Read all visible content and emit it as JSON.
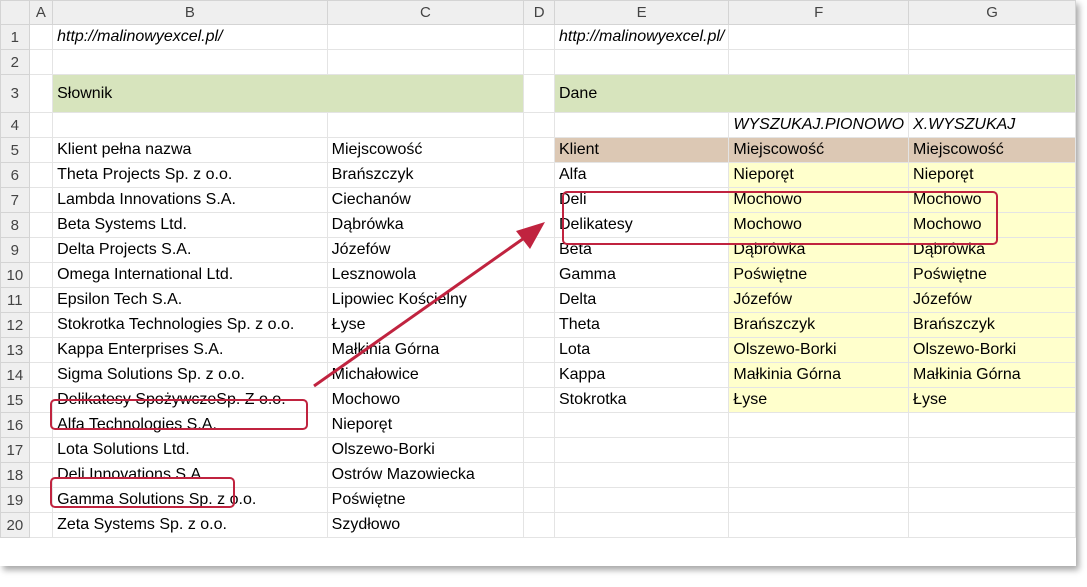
{
  "columns": [
    "",
    "A",
    "B",
    "C",
    "D",
    "E",
    "F",
    "G"
  ],
  "rows": [
    "1",
    "2",
    "3",
    "4",
    "5",
    "6",
    "7",
    "8",
    "9",
    "10",
    "11",
    "12",
    "13",
    "14",
    "15",
    "16",
    "17",
    "18",
    "19",
    "20"
  ],
  "link_left": "http://malinowyexcel.pl/",
  "link_right": "http://malinowyexcel.pl/",
  "dictionary": {
    "title": "Słownik",
    "header_client": "Klient pełna nazwa",
    "header_city": "Miejscowość",
    "rows": [
      {
        "client": "Theta Projects Sp. z o.o.",
        "city": "Brańszczyk"
      },
      {
        "client": "Lambda Innovations S.A.",
        "city": "Ciechanów"
      },
      {
        "client": "Beta Systems Ltd.",
        "city": "Dąbrówka"
      },
      {
        "client": "Delta Projects S.A.",
        "city": "Józefów"
      },
      {
        "client": "Omega International Ltd.",
        "city": "Lesznowola"
      },
      {
        "client": "Epsilon Tech S.A.",
        "city": "Lipowiec Kościelny"
      },
      {
        "client": "Stokrotka Technologies Sp. z o.o.",
        "city": "Łyse"
      },
      {
        "client": "Kappa Enterprises S.A.",
        "city": "Małkinia Górna"
      },
      {
        "client": "Sigma Solutions Sp. z o.o.",
        "city": "Michałowice"
      },
      {
        "client": "Delikatesy SpożywczeSp. Z o.o.",
        "city": "Mochowo"
      },
      {
        "client": "Alfa Technologies S.A.",
        "city": "Nieporęt"
      },
      {
        "client": "Lota Solutions Ltd.",
        "city": "Olszewo-Borki"
      },
      {
        "client": "Deli Innovations S.A.",
        "city": "Ostrów Mazowiecka"
      },
      {
        "client": "Gamma Solutions Sp. z o.o.",
        "city": "Poświętne"
      },
      {
        "client": "Zeta Systems Sp. z o.o.",
        "city": "Szydłowo"
      }
    ]
  },
  "data_table": {
    "title": "Dane",
    "note_f": "WYSZUKAJ.PIONOWO",
    "note_g": "X.WYSZUKAJ",
    "header_client": "Klient",
    "header_city_f": "Miejscowość",
    "header_city_g": "Miejscowość",
    "rows": [
      {
        "client": "Alfa",
        "vlookup": "Nieporęt",
        "xlookup": "Nieporęt"
      },
      {
        "client": "Deli",
        "vlookup": "Mochowo",
        "xlookup": "Mochowo"
      },
      {
        "client": "Delikatesy",
        "vlookup": "Mochowo",
        "xlookup": "Mochowo"
      },
      {
        "client": "Beta",
        "vlookup": "Dąbrówka",
        "xlookup": "Dąbrówka"
      },
      {
        "client": "Gamma",
        "vlookup": "Poświętne",
        "xlookup": "Poświętne"
      },
      {
        "client": "Delta",
        "vlookup": "Józefów",
        "xlookup": "Józefów"
      },
      {
        "client": "Theta",
        "vlookup": "Brańszczyk",
        "xlookup": "Brańszczyk"
      },
      {
        "client": "Lota",
        "vlookup": "Olszewo-Borki",
        "xlookup": "Olszewo-Borki"
      },
      {
        "client": "Kappa",
        "vlookup": "Małkinia Górna",
        "xlookup": "Małkinia Górna"
      },
      {
        "client": "Stokrotka",
        "vlookup": "Łyse",
        "xlookup": "Łyse"
      }
    ]
  },
  "colors": {
    "accent": "#c0233f",
    "title_bg": "#d7e4bd",
    "header_bg": "#dcc8b4",
    "result_bg": "#ffffcc",
    "result_text": "#1f3fd6"
  }
}
